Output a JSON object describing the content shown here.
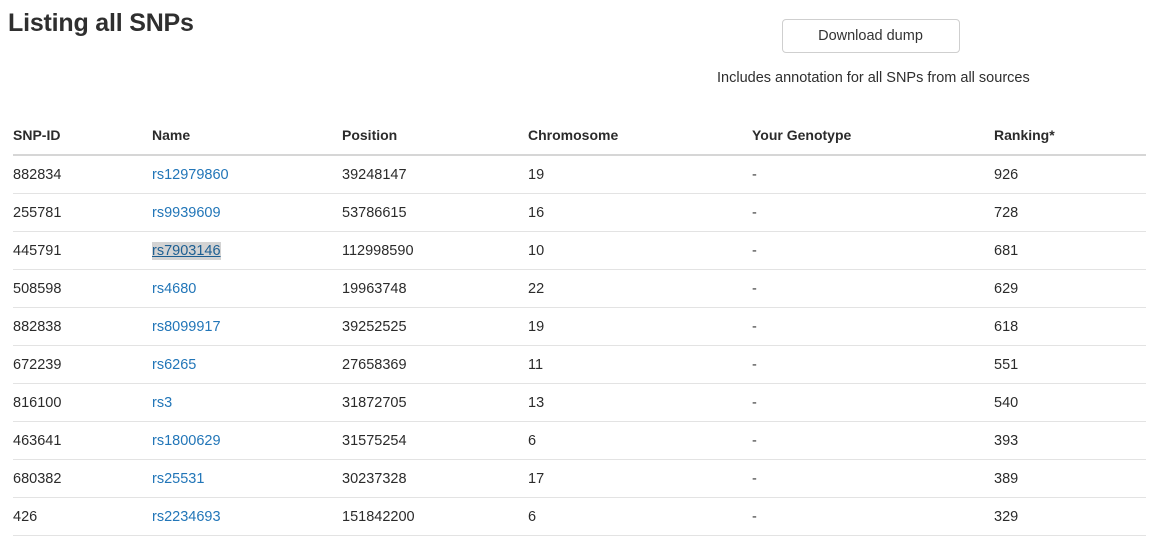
{
  "header": {
    "title": "Listing all SNPs",
    "download_button_label": "Download dump",
    "download_caption": "Includes annotation for all SNPs from all sources"
  },
  "colors": {
    "link": "#2276b8",
    "link_active_bg": "#d3d3d3",
    "text": "#2b2b2b",
    "row_border": "#e3e3e3",
    "header_border": "#d6d6d6",
    "button_border": "#cfcfcf"
  },
  "table": {
    "columns": [
      {
        "key": "snp_id",
        "label": "SNP-ID"
      },
      {
        "key": "name",
        "label": "Name"
      },
      {
        "key": "position",
        "label": "Position"
      },
      {
        "key": "chromosome",
        "label": "Chromosome"
      },
      {
        "key": "genotype",
        "label": "Your Genotype"
      },
      {
        "key": "ranking",
        "label": "Ranking*"
      }
    ],
    "rows": [
      {
        "snp_id": "882834",
        "name": "rs12979860",
        "position": "39248147",
        "chromosome": "19",
        "genotype": "-",
        "ranking": "926",
        "active": false
      },
      {
        "snp_id": "255781",
        "name": "rs9939609",
        "position": "53786615",
        "chromosome": "16",
        "genotype": "-",
        "ranking": "728",
        "active": false
      },
      {
        "snp_id": "445791",
        "name": "rs7903146",
        "position": "112998590",
        "chromosome": "10",
        "genotype": "-",
        "ranking": "681",
        "active": true
      },
      {
        "snp_id": "508598",
        "name": "rs4680",
        "position": "19963748",
        "chromosome": "22",
        "genotype": "-",
        "ranking": "629",
        "active": false
      },
      {
        "snp_id": "882838",
        "name": "rs8099917",
        "position": "39252525",
        "chromosome": "19",
        "genotype": "-",
        "ranking": "618",
        "active": false
      },
      {
        "snp_id": "672239",
        "name": "rs6265",
        "position": "27658369",
        "chromosome": "11",
        "genotype": "-",
        "ranking": "551",
        "active": false
      },
      {
        "snp_id": "816100",
        "name": "rs3",
        "position": "31872705",
        "chromosome": "13",
        "genotype": "-",
        "ranking": "540",
        "active": false
      },
      {
        "snp_id": "463641",
        "name": "rs1800629",
        "position": "31575254",
        "chromosome": "6",
        "genotype": "-",
        "ranking": "393",
        "active": false
      },
      {
        "snp_id": "680382",
        "name": "rs25531",
        "position": "30237328",
        "chromosome": "17",
        "genotype": "-",
        "ranking": "389",
        "active": false
      },
      {
        "snp_id": "426",
        "name": "rs2234693",
        "position": "151842200",
        "chromosome": "6",
        "genotype": "-",
        "ranking": "329",
        "active": false
      }
    ]
  }
}
